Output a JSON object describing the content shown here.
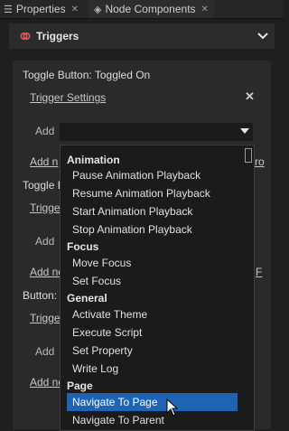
{
  "tabs": [
    {
      "label": "Properties",
      "icon": "list-icon",
      "close": "✕"
    },
    {
      "label": "Node Components",
      "icon": "components-icon",
      "close": "✕"
    }
  ],
  "section": {
    "title": "Triggers",
    "icon": "trigger-icon"
  },
  "components": [
    {
      "title": "Toggle Button: Toggled On",
      "trigger_settings": "Trigger Settings",
      "add_label": "Add",
      "add_node": "Add n"
    },
    {
      "title": "Toggle B",
      "trigger_settings": "Trigge",
      "add_label": "Add",
      "add_node": "Add no"
    },
    {
      "title": "Button:",
      "trigger_settings": "Trigge",
      "add_label": "Add",
      "add_node": "Add no"
    }
  ],
  "overflow_fragments": {
    "row1": "ro",
    "row2": "F"
  },
  "remove_symbol": "✕",
  "dropdown": {
    "groups": [
      {
        "label": "Animation",
        "items": [
          "Pause Animation Playback",
          "Resume Animation Playback",
          "Start Animation Playback",
          "Stop Animation Playback"
        ]
      },
      {
        "label": "Focus",
        "items": [
          "Move Focus",
          "Set Focus"
        ]
      },
      {
        "label": "General",
        "items": [
          "Activate Theme",
          "Execute Script",
          "Set Property",
          "Write Log"
        ]
      },
      {
        "label": "Page",
        "items": [
          "Navigate To Page",
          "Navigate To Parent"
        ]
      }
    ],
    "selected": "Navigate To Page"
  },
  "colors": {
    "selection": "#1e64b4",
    "background": "#1f1f1f",
    "panel": "#2a2a2a"
  }
}
